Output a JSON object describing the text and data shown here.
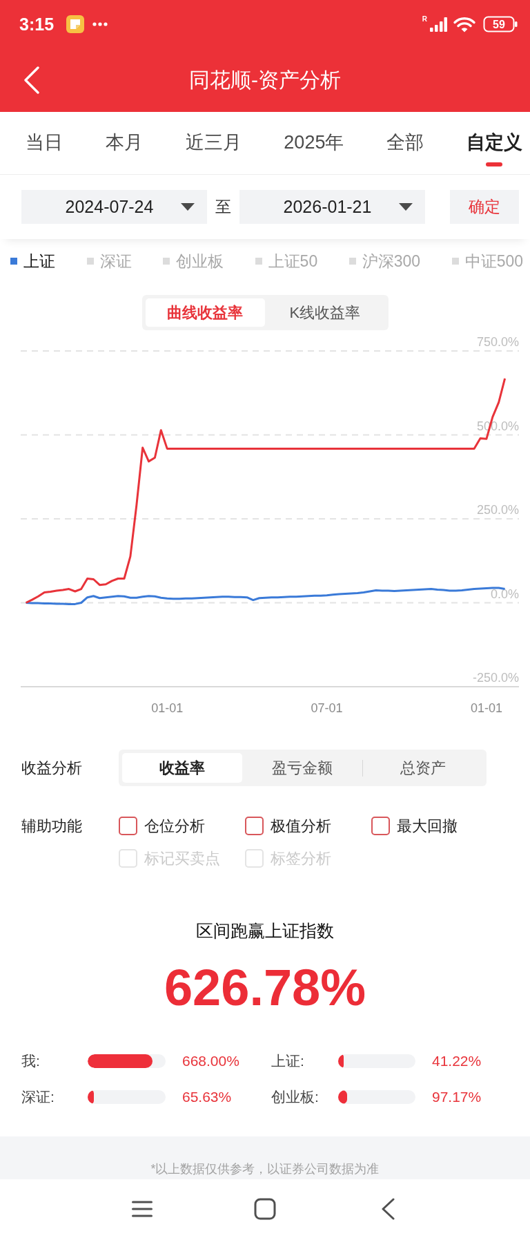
{
  "status_bar": {
    "time": "3:15",
    "network_label": "R",
    "battery": "59"
  },
  "header": {
    "title": "同花顺-资产分析"
  },
  "period_tabs": [
    {
      "label": "当日",
      "selected": false
    },
    {
      "label": "本月",
      "selected": false
    },
    {
      "label": "近三月",
      "selected": false
    },
    {
      "label": "2025年",
      "selected": false
    },
    {
      "label": "全部",
      "selected": false
    },
    {
      "label": "自定义",
      "selected": true
    }
  ],
  "date_range": {
    "start": "2024-07-24",
    "separator": "至",
    "end": "2026-01-21",
    "confirm": "确定"
  },
  "index_legend": [
    {
      "label": "上证",
      "selected": true
    },
    {
      "label": "深证",
      "selected": false
    },
    {
      "label": "创业板",
      "selected": false
    },
    {
      "label": "上证50",
      "selected": false
    },
    {
      "label": "沪深300",
      "selected": false
    },
    {
      "label": "中证500",
      "selected": false
    }
  ],
  "chart_mode": [
    {
      "label": "曲线收益率",
      "selected": true
    },
    {
      "label": "K线收益率",
      "selected": false
    }
  ],
  "chart": {
    "chart_data": {
      "type": "line",
      "grid": true,
      "categories": [
        null,
        null,
        null,
        null,
        null,
        null,
        null,
        null,
        null,
        null,
        null,
        null,
        null,
        null,
        null,
        null,
        null,
        null,
        null,
        null,
        null,
        null,
        null,
        "01-01",
        null,
        null,
        null,
        null,
        null,
        null,
        null,
        null,
        null,
        null,
        null,
        null,
        null,
        null,
        null,
        null,
        null,
        null,
        null,
        null,
        null,
        null,
        null,
        null,
        null,
        "07-01",
        null,
        null,
        null,
        null,
        null,
        null,
        null,
        null,
        null,
        null,
        null,
        null,
        null,
        null,
        null,
        null,
        null,
        null,
        null,
        null,
        null,
        null,
        null,
        null,
        null,
        "01-01",
        null,
        null,
        null
      ],
      "series": [
        {
          "color": "#e8333a",
          "values": [
            0,
            9,
            19,
            31,
            33,
            36,
            38,
            41,
            34,
            41,
            72,
            70,
            53,
            55,
            65,
            72,
            72,
            138,
            290,
            462,
            421,
            432,
            514,
            459,
            459,
            459,
            459,
            459,
            459,
            459,
            459,
            459,
            459,
            459,
            459,
            459,
            459,
            459,
            459,
            459,
            459,
            459,
            459,
            459,
            459,
            459,
            459,
            459,
            459,
            459,
            459,
            459,
            459,
            459,
            459,
            459,
            459,
            459,
            459,
            459,
            459,
            459,
            459,
            459,
            459,
            459,
            459,
            459,
            459,
            459,
            459,
            459,
            459,
            459,
            490,
            488,
            553,
            597,
            668
          ]
        },
        {
          "color": "#3a7ad8",
          "values": [
            0,
            -1,
            -1,
            -2,
            -2,
            -3,
            -3,
            -4,
            -4,
            0,
            16,
            20,
            14,
            16,
            18,
            20,
            19,
            15,
            15,
            18,
            20,
            19,
            15,
            13,
            12,
            12,
            13,
            13,
            14,
            15,
            16,
            17,
            18,
            18,
            17,
            17,
            16,
            8,
            14,
            15,
            16,
            16,
            17,
            18,
            18,
            19,
            20,
            21,
            21,
            22,
            24,
            26,
            27,
            28,
            29,
            31,
            34,
            37,
            36,
            36,
            35,
            36,
            37,
            38,
            39,
            40,
            41,
            39,
            38,
            36,
            36,
            37,
            39,
            41,
            42,
            43,
            44,
            44,
            41
          ]
        }
      ],
      "ylim": [
        -250,
        750
      ],
      "yticks": [
        {
          "value": 750,
          "label": "750.0%"
        },
        {
          "value": 500,
          "label": "500.0%"
        },
        {
          "value": 250,
          "label": "250.0%"
        },
        {
          "value": 0,
          "label": "0.0%"
        },
        {
          "value": -250,
          "label": "-250.0%"
        }
      ]
    }
  },
  "analysis": {
    "label": "收益分析",
    "options": [
      {
        "label": "收益率",
        "selected": true
      },
      {
        "label": "盈亏金额",
        "selected": false
      },
      {
        "label": "总资产",
        "selected": false
      }
    ]
  },
  "aux": {
    "label": "辅助功能",
    "options": [
      {
        "label": "仓位分析",
        "checked": false,
        "disabled": false
      },
      {
        "label": "极值分析",
        "checked": false,
        "disabled": false
      },
      {
        "label": "最大回撤",
        "checked": false,
        "disabled": false
      },
      {
        "label": "标记买卖点",
        "checked": false,
        "disabled": true
      },
      {
        "label": "标签分析",
        "checked": false,
        "disabled": true
      }
    ]
  },
  "summary": {
    "title": "区间跑赢上证指数",
    "value": "626.78%",
    "bars": [
      {
        "label": "我:",
        "level": 0.835,
        "reading": "668.00%"
      },
      {
        "label": "上证:",
        "level": 0.05,
        "reading": "41.22%"
      },
      {
        "label": "深证:",
        "level": 0.08,
        "reading": "65.63%"
      },
      {
        "label": "创业板:",
        "level": 0.12,
        "reading": "97.17%"
      }
    ]
  },
  "disclaimer": "*以上数据仅供参考，以证券公司数据为准"
}
